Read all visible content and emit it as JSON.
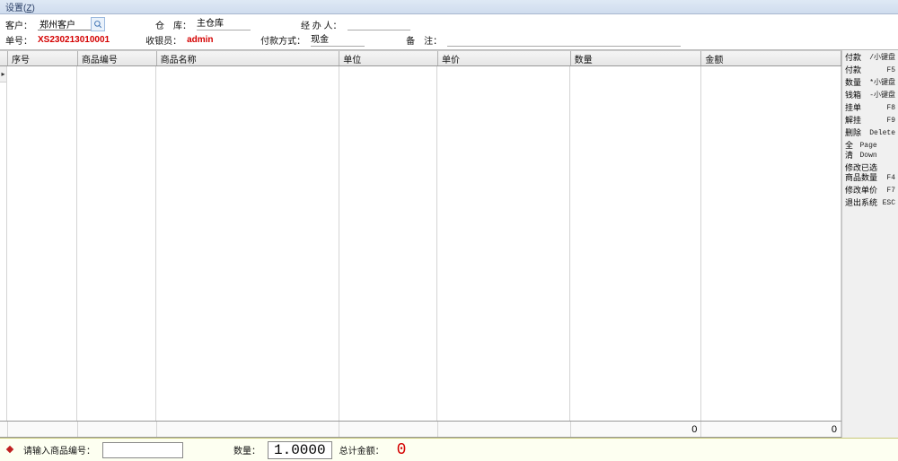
{
  "menu": {
    "settings": {
      "text": "设置",
      "hotkey": "Z"
    }
  },
  "form": {
    "customer": {
      "label": "客户：",
      "value": "郑州客户"
    },
    "warehouse": {
      "label": "仓　库：",
      "value": "主仓库"
    },
    "operator": {
      "label": "经 办 人：",
      "value": ""
    },
    "bill_no": {
      "label": "单号：",
      "value": "XS230213010001"
    },
    "cashier": {
      "label": "收银员：",
      "value": "admin"
    },
    "pay_method": {
      "label": "付款方式：",
      "value": "现金"
    },
    "remark": {
      "label": "备　注：",
      "value": ""
    }
  },
  "grid": {
    "columns": [
      "序号",
      "商品编号",
      "商品名称",
      "单位",
      "单价",
      "数量",
      "金额"
    ],
    "rows": [],
    "totals": {
      "qty": "0",
      "amount": "0"
    }
  },
  "shortcuts": [
    {
      "label": "付款",
      "key": "/小键盘"
    },
    {
      "label": "付款",
      "key": "F5"
    },
    {
      "label": "数量",
      "key": "*小键盘"
    },
    {
      "label": "钱箱",
      "key": "-小键盘"
    },
    {
      "label": "挂单",
      "key": "F8"
    },
    {
      "label": "解挂",
      "key": "F9"
    },
    {
      "label": "删除",
      "key": "Delete"
    },
    {
      "label": "全清",
      "key": "Page Down"
    },
    {
      "label": "修改已选",
      "label2": "商品数量",
      "key": "F4"
    },
    {
      "label": "修改单价",
      "key": "F7"
    },
    {
      "label": "退出系统",
      "key": "ESC"
    }
  ],
  "footer": {
    "code_label": "请输入商品编号：",
    "code_value": "",
    "qty_label": "数量：",
    "qty_value": "1.0000",
    "total_label": "总计金额：",
    "total_value": "0"
  }
}
